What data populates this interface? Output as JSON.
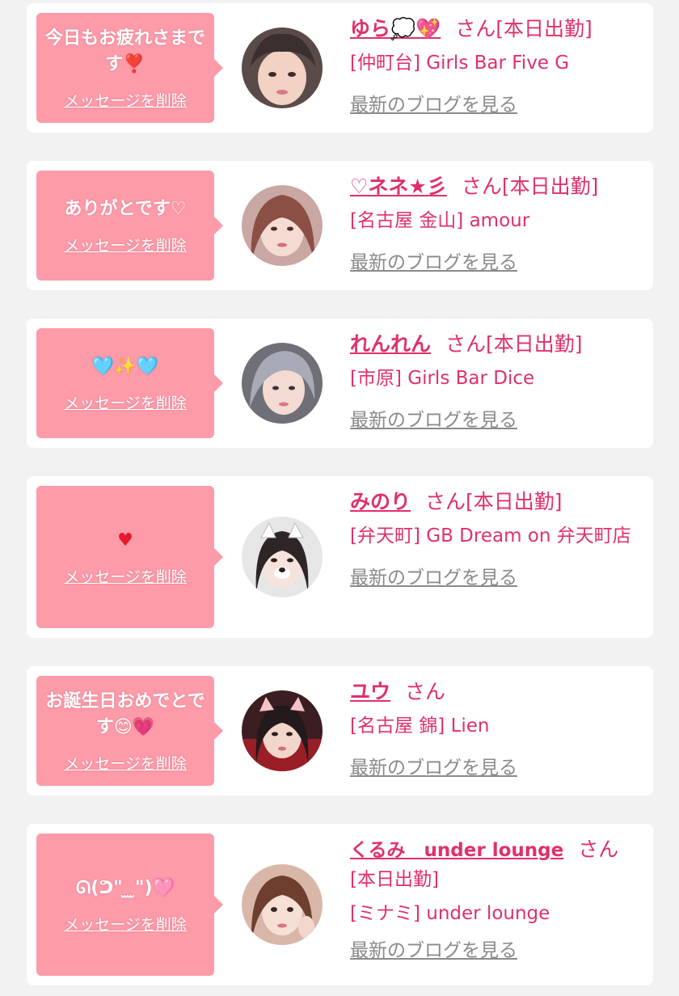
{
  "suffix": "さん",
  "working_label": "[本日出勤]",
  "delete_label": "メッセージを削除",
  "blog_label": "最新のブログを見る",
  "cards": [
    {
      "message": "今日もお疲れさまです❣️",
      "name": "ゆら💭💖",
      "status": "さん[本日出勤]",
      "shop": "[仲町台] Girls Bar Five G"
    },
    {
      "message": "ありがとです♡",
      "name": "♡ネネ★彡",
      "status": "さん[本日出勤]",
      "shop": "[名古屋 金山] amour"
    },
    {
      "message": "🩵✨🩵",
      "name": "れんれん",
      "status": "さん[本日出勤]",
      "shop": "[市原] Girls Bar Dice"
    },
    {
      "message": "♥",
      "name": "みのり",
      "status": "さん[本日出勤]",
      "shop": "[弁天町] GB Dream on 弁天町店"
    },
    {
      "message": "お誕生日おめでとです😊💗",
      "name": "ユウ",
      "status": "さん",
      "shop": "[名古屋 錦] Lien"
    },
    {
      "message": "ᘏ(ᕤ\" ̫ ̫\")🩷",
      "name": "くるみ　under lounge",
      "status": "さん",
      "status2": "[本日出勤]",
      "shop": "[ミナミ] under lounge"
    }
  ],
  "colors": {
    "accent": "#e0306b",
    "bubble": "#fd9ba9",
    "link_gray": "#8a8a8a",
    "background": "#f2f2f2"
  }
}
